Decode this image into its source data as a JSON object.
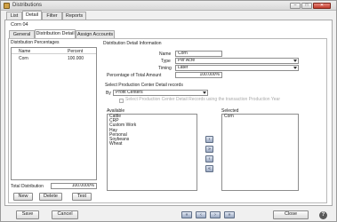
{
  "window": {
    "title": "Distributions"
  },
  "window_controls": {
    "minimize": "–",
    "maximize": "□",
    "close": "✕"
  },
  "tabs": [
    {
      "label": "List"
    },
    {
      "label": "Detail"
    },
    {
      "label": "Filter"
    },
    {
      "label": "Reports"
    }
  ],
  "record_name": "Corn 04",
  "subtabs": [
    {
      "label": "General"
    },
    {
      "label": "Distribution Detail"
    },
    {
      "label": "Assign Accounts"
    }
  ],
  "percentages": {
    "group_title": "Distribution Percentages",
    "columns": [
      "Name",
      "Percent"
    ],
    "rows": [
      {
        "name": "Corn",
        "percent": "100.000"
      }
    ],
    "total_label": "Total Distribution",
    "total_value": "100.0000%",
    "buttons": {
      "new": "New",
      "delete": "Delete",
      "test": "Test"
    }
  },
  "info": {
    "group_title": "Distribution Detail Information",
    "name_label": "Name",
    "name_value": "Corn",
    "type_label": "Type",
    "type_value": "Per Acre",
    "timing_label": "Timing",
    "timing_value": "Later",
    "pct_label": "Percentage of Total Amount",
    "pct_value": "100.000%"
  },
  "records": {
    "group_title": "Select Production Center Detail records",
    "by_label": "By",
    "by_value": "Profit Centers",
    "checkbox_label": "Select Production Center Detail Records using the transaction Production Year",
    "available_label": "Available",
    "available_items": [
      "Cattle",
      "CRP",
      "Custom Work",
      "Hay",
      "Personal",
      "Soybeans",
      "Wheat"
    ],
    "selected_label": "Selected",
    "selected_items": [
      "Corn"
    ],
    "arrows": {
      "add_one": "›",
      "add_all": "»",
      "remove_one": "‹",
      "remove_all": "«"
    }
  },
  "footer": {
    "save": "Save",
    "cancel": "Cancel",
    "close": "Close",
    "help": "?",
    "nav": {
      "first": "«",
      "prev": "‹",
      "next": "›",
      "last": "»"
    }
  }
}
